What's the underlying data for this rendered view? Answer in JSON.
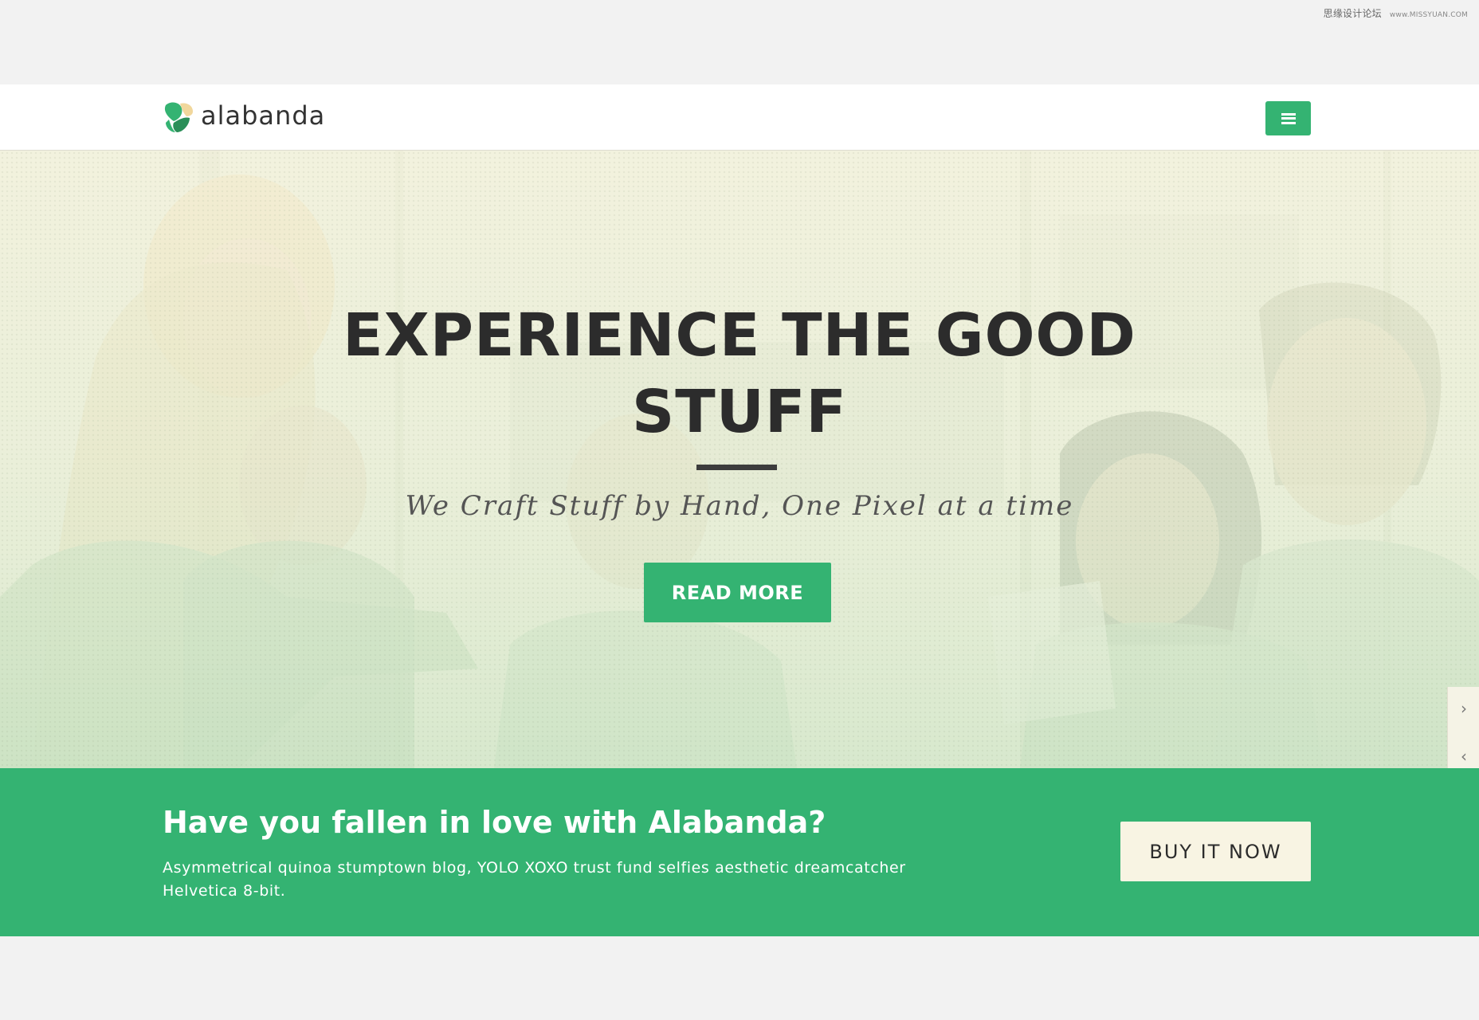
{
  "watermark": {
    "text": "思缘设计论坛",
    "url": "www.MISSYUAN.COM"
  },
  "header": {
    "logo_text": "alabanda",
    "menu_icon": "hamburger-icon"
  },
  "hero": {
    "title": "EXPERIENCE THE GOOD STUFF",
    "subtitle": "We Craft Stuff by Hand, One Pixel at a time",
    "cta_label": "READ MORE",
    "next_arrow": "›",
    "prev_arrow": "‹"
  },
  "cta_band": {
    "heading": "Have you fallen in love with Alabanda?",
    "text": "Asymmetrical quinoa stumptown blog, YOLO XOXO trust fund selfies aesthetic dreamcatcher Helvetica 8-bit.",
    "button_label": "BUY IT NOW"
  },
  "colors": {
    "brand_green": "#34b372",
    "header_bg": "#ffffff",
    "page_bg": "#f2f2f2",
    "button_cream": "#f8f4e3",
    "text_dark": "#2c2c2c"
  }
}
